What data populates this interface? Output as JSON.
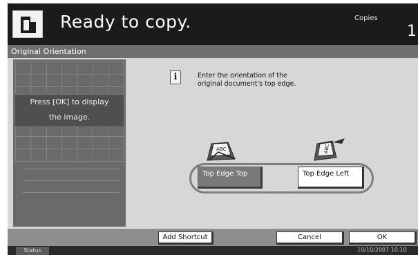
{
  "header": {
    "status_message": "Ready to copy.",
    "copies_label": "Copies",
    "copies_count": "1"
  },
  "screen_title": "Original Orientation",
  "preview": {
    "message_line1": "Press [OK] to display",
    "message_line2": "the image."
  },
  "instruction": {
    "icon": "info-icon",
    "icon_glyph": "i",
    "line1": "Enter the orientation of the",
    "line2": "original document's top edge."
  },
  "orientation": {
    "options": [
      {
        "label": "Top Edge Top",
        "icon": "top-edge-top-icon",
        "selected": true
      },
      {
        "label": "Top Edge Left",
        "icon": "top-edge-left-icon",
        "selected": false
      }
    ]
  },
  "bottom_buttons": {
    "add_shortcut": "Add Shortcut",
    "cancel": "Cancel",
    "ok": "OK"
  },
  "status_bar": {
    "status_label": "Status",
    "datetime": "10/10/2007  10:10"
  },
  "colors": {
    "screen_bg": "#1b1b1b",
    "panel_bg": "#d7d7d7",
    "title_strip": "#6f6f6f",
    "selected_button": "#7a7a7a"
  }
}
